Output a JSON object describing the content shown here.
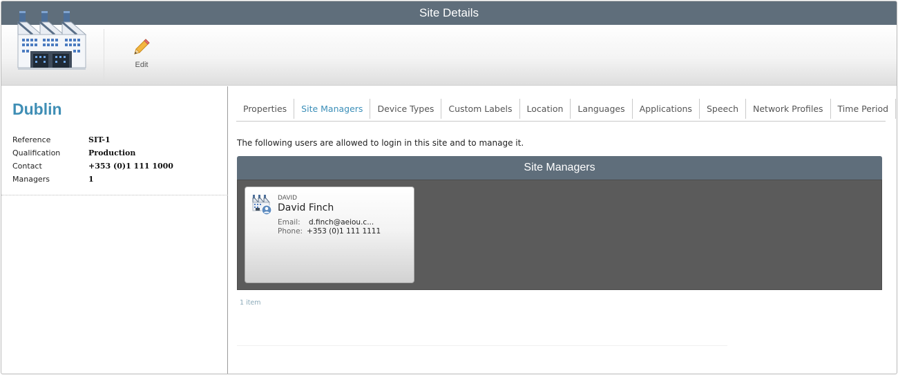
{
  "window": {
    "title": "Site Details"
  },
  "toolbar": {
    "edit_label": "Edit"
  },
  "site": {
    "name": "Dublin",
    "fields": [
      {
        "key": "Reference",
        "value": "SIT-1"
      },
      {
        "key": "Qualification",
        "value": "Production"
      },
      {
        "key": "Contact",
        "value": "+353 (0)1 111 1000"
      },
      {
        "key": "Managers",
        "value": "1"
      }
    ]
  },
  "tabs": [
    {
      "label": "Properties",
      "active": false
    },
    {
      "label": "Site Managers",
      "active": true
    },
    {
      "label": "Device Types",
      "active": false
    },
    {
      "label": "Custom Labels",
      "active": false
    },
    {
      "label": "Location",
      "active": false
    },
    {
      "label": "Languages",
      "active": false
    },
    {
      "label": "Applications",
      "active": false
    },
    {
      "label": "Speech",
      "active": false
    },
    {
      "label": "Network Profiles",
      "active": false
    },
    {
      "label": "Time Period",
      "active": false
    }
  ],
  "main": {
    "description": "The following users are allowed to login in this site and to manage it.",
    "panel_title": "Site Managers",
    "managers": [
      {
        "username": "DAVID",
        "full_name": "David Finch",
        "email_label": "Email:",
        "email": "d.finch@aeiou.c...",
        "phone_label": "Phone:",
        "phone": "+353 (0)1 111 1111"
      }
    ],
    "item_count": "1 item"
  },
  "colors": {
    "header": "#5f6e7b",
    "accent": "#3f8eb5",
    "active_tab": "#3a8eb8",
    "panel_body": "#5b5b5b"
  },
  "icons": {
    "site_logo": "factory-building-icon",
    "edit": "pencil-icon",
    "manager": "site-manager-user-icon"
  }
}
